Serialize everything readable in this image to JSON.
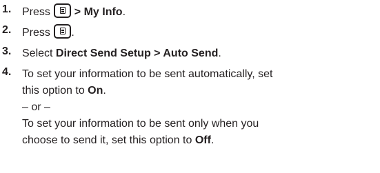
{
  "steps": [
    {
      "number": "1.",
      "before": "Press ",
      "key_icon": "menu-key-icon",
      "bold": " > My Info",
      "after": "."
    },
    {
      "number": "2.",
      "before": "Press ",
      "key_icon": "menu-key-icon",
      "after": "."
    },
    {
      "number": "3.",
      "before": "Select ",
      "bold": "Direct Send Setup > Auto Send",
      "after": "."
    },
    {
      "number": "4.",
      "line1": "To set your information to be sent automatically, set",
      "line2_before": "this option to ",
      "line2_bold": "On",
      "line2_after": ".",
      "separator": "– or –",
      "line4": "To set your information to be sent only when you",
      "line5_before": "choose to send it, set this option to ",
      "line5_bold": "Off",
      "line5_after": "."
    }
  ]
}
